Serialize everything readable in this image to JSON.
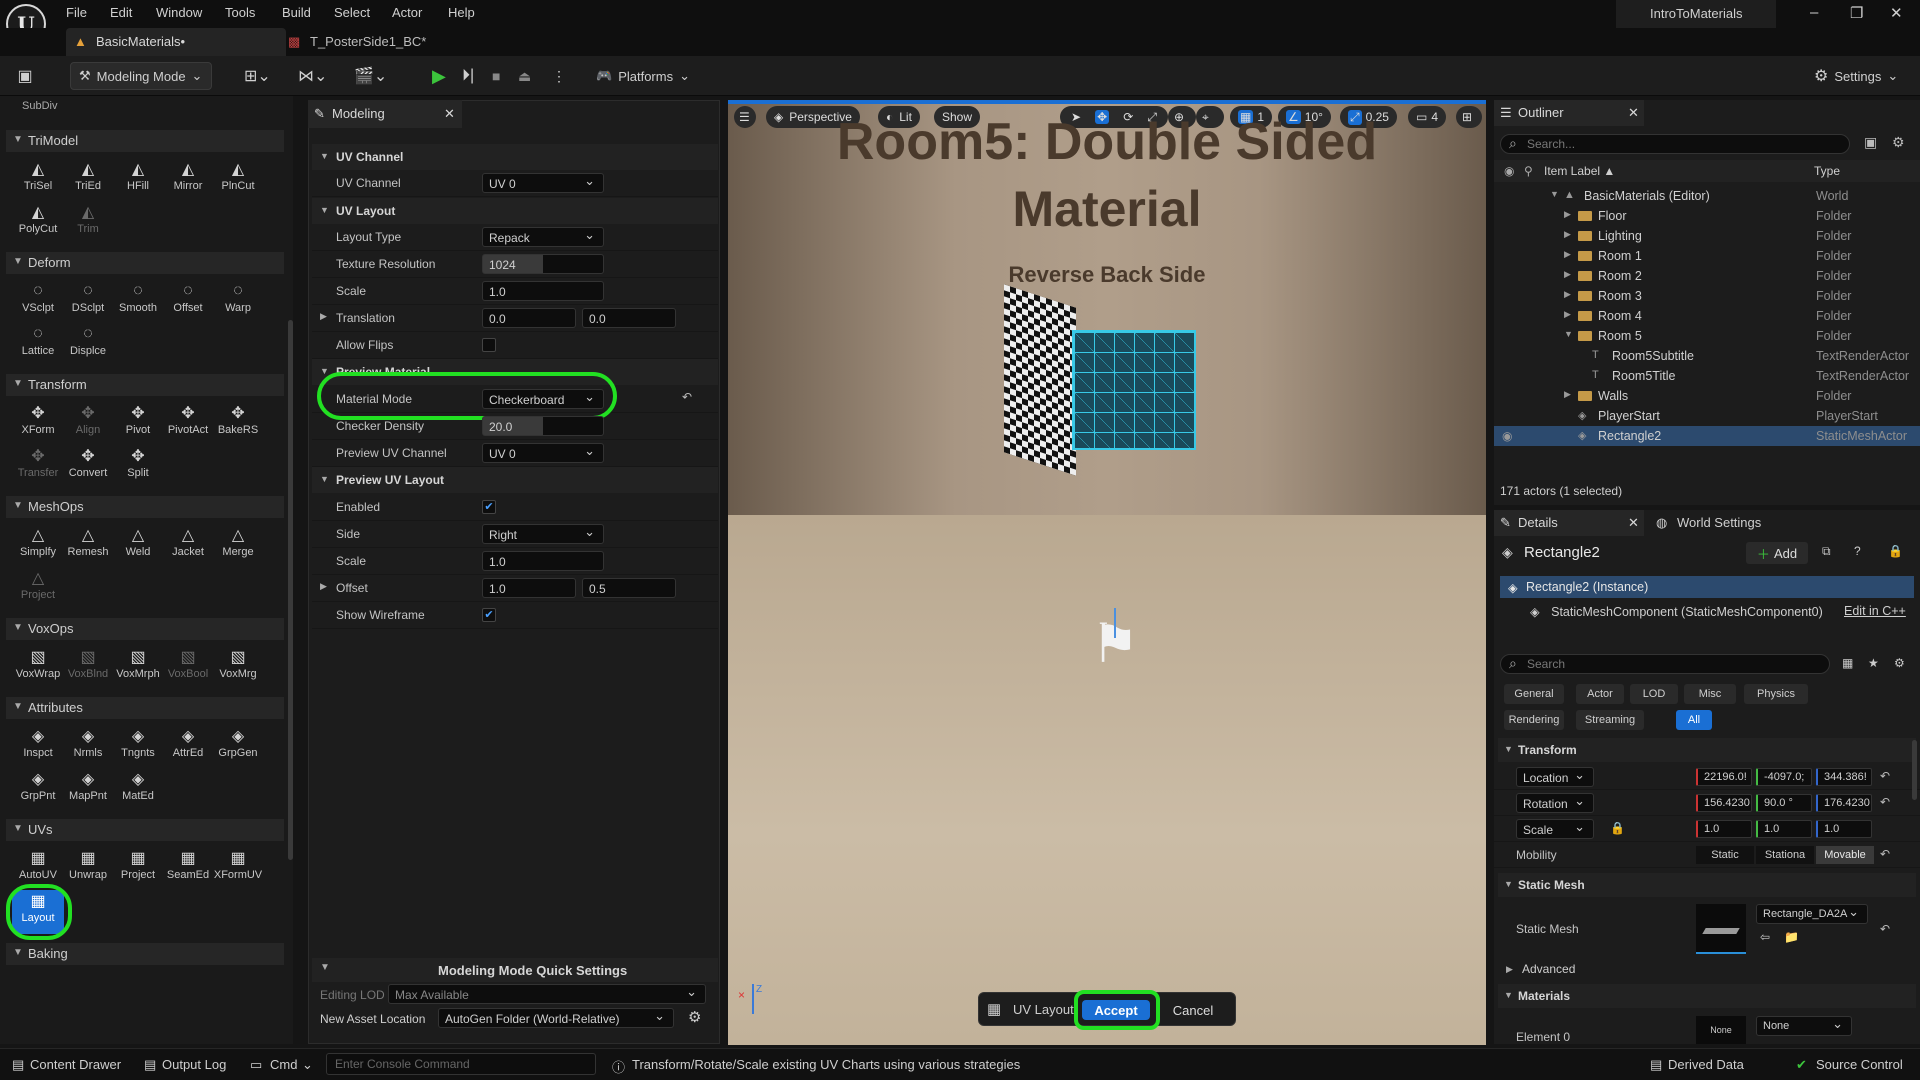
{
  "menu": [
    "File",
    "Edit",
    "Window",
    "Tools",
    "Build",
    "Select",
    "Actor",
    "Help"
  ],
  "project": "IntroToMaterials",
  "tabs": {
    "level": "BasicMaterials•",
    "texture": "T_PosterSide1_BC*"
  },
  "toolbar": {
    "mode": "Modeling Mode",
    "platforms": "Platforms",
    "settings": "Settings"
  },
  "palette": {
    "subdiv": "SubDiv",
    "sections": [
      {
        "name": "TriModel",
        "tools": [
          {
            "label": "TriSel",
            "icon": "triangle-select-icon"
          },
          {
            "label": "TriEd",
            "icon": "triangle-edit-icon"
          },
          {
            "label": "HFill",
            "icon": "hole-fill-icon"
          },
          {
            "label": "Mirror",
            "icon": "mirror-icon"
          },
          {
            "label": "PlnCut",
            "icon": "plane-cut-icon"
          },
          {
            "label": "PolyCut",
            "icon": "poly-cut-icon"
          },
          {
            "label": "Trim",
            "icon": "trim-icon",
            "dim": true
          }
        ]
      },
      {
        "name": "Deform",
        "tools": [
          {
            "label": "VSclpt",
            "icon": "vertex-sculpt-icon"
          },
          {
            "label": "DSclpt",
            "icon": "dynamic-sculpt-icon"
          },
          {
            "label": "Smooth",
            "icon": "smooth-icon"
          },
          {
            "label": "Offset",
            "icon": "offset-icon"
          },
          {
            "label": "Warp",
            "icon": "warp-icon"
          },
          {
            "label": "Lattice",
            "icon": "lattice-icon"
          },
          {
            "label": "Displce",
            "icon": "displace-icon"
          }
        ]
      },
      {
        "name": "Transform",
        "tools": [
          {
            "label": "XForm",
            "icon": "xform-icon"
          },
          {
            "label": "Align",
            "icon": "align-icon",
            "dim": true
          },
          {
            "label": "Pivot",
            "icon": "pivot-icon"
          },
          {
            "label": "PivotAct",
            "icon": "pivot-actor-icon"
          },
          {
            "label": "BakeRS",
            "icon": "bake-rs-icon"
          },
          {
            "label": "Transfer",
            "icon": "transfer-icon",
            "dim": true
          },
          {
            "label": "Convert",
            "icon": "convert-icon"
          },
          {
            "label": "Split",
            "icon": "split-icon"
          }
        ]
      },
      {
        "name": "MeshOps",
        "tools": [
          {
            "label": "Simplfy",
            "icon": "simplify-icon"
          },
          {
            "label": "Remesh",
            "icon": "remesh-icon"
          },
          {
            "label": "Weld",
            "icon": "weld-icon"
          },
          {
            "label": "Jacket",
            "icon": "jacket-icon"
          },
          {
            "label": "Merge",
            "icon": "merge-icon"
          },
          {
            "label": "Project",
            "icon": "project-icon",
            "dim": true
          }
        ]
      },
      {
        "name": "VoxOps",
        "tools": [
          {
            "label": "VoxWrap",
            "icon": "vox-wrap-icon"
          },
          {
            "label": "VoxBlnd",
            "icon": "vox-blend-icon",
            "dim": true
          },
          {
            "label": "VoxMrph",
            "icon": "vox-morph-icon"
          },
          {
            "label": "VoxBool",
            "icon": "vox-bool-icon",
            "dim": true
          },
          {
            "label": "VoxMrg",
            "icon": "vox-merge-icon"
          }
        ]
      },
      {
        "name": "Attributes",
        "tools": [
          {
            "label": "Inspct",
            "icon": "inspect-icon"
          },
          {
            "label": "Nrmls",
            "icon": "normals-icon"
          },
          {
            "label": "Tngnts",
            "icon": "tangents-icon"
          },
          {
            "label": "AttrEd",
            "icon": "attr-edit-icon"
          },
          {
            "label": "GrpGen",
            "icon": "group-gen-icon"
          },
          {
            "label": "GrpPnt",
            "icon": "group-paint-icon"
          },
          {
            "label": "MapPnt",
            "icon": "map-paint-icon"
          },
          {
            "label": "MatEd",
            "icon": "mat-edit-icon"
          }
        ]
      },
      {
        "name": "UVs",
        "tools": [
          {
            "label": "AutoUV",
            "icon": "auto-uv-icon"
          },
          {
            "label": "Unwrap",
            "icon": "unwrap-icon"
          },
          {
            "label": "Project",
            "icon": "uv-project-icon"
          },
          {
            "label": "SeamEd",
            "icon": "seam-edit-icon"
          },
          {
            "label": "XFormUV",
            "icon": "xform-uv-icon"
          }
        ]
      },
      {
        "name": "Baking",
        "tools": []
      }
    ],
    "layout": "Layout"
  },
  "modeling": {
    "tab": "Modeling",
    "uv_channel": {
      "title": "UV Channel",
      "label": "UV Channel",
      "value": "UV 0"
    },
    "uv_layout": {
      "title": "UV Layout",
      "layout_type": "Layout Type",
      "layout_value": "Repack",
      "texres_label": "Texture Resolution",
      "texres": "1024",
      "scale_label": "Scale",
      "scale": "1.0",
      "translation_label": "Translation",
      "tx": "0.0",
      "ty": "0.0",
      "flips_label": "Allow Flips"
    },
    "preview_material": {
      "title": "Preview Material",
      "mode_label": "Material Mode",
      "mode": "Checkerboard",
      "density_label": "Checker Density",
      "density": "20.0",
      "channel_label": "Preview UV Channel",
      "channel": "UV 0"
    },
    "preview_uv": {
      "title": "Preview UV Layout",
      "enabled_label": "Enabled",
      "side_label": "Side",
      "side": "Right",
      "scale_label": "Scale",
      "scale": "1.0",
      "offset_label": "Offset",
      "ox": "1.0",
      "oy": "0.5",
      "wire_label": "Show Wireframe"
    },
    "quick": {
      "title": "Modeling Mode Quick Settings",
      "lod_label": "Editing LOD",
      "lod": "Max Available",
      "loc_label": "New Asset Location",
      "loc": "AutoGen Folder (World-Relative)"
    }
  },
  "viewport": {
    "perspective": "Perspective",
    "lit": "Lit",
    "show": "Show",
    "angle": "10°",
    "scale": "0.25",
    "grid": "1",
    "cam": "4",
    "title1": "Room5: Double Sided",
    "title2": "Material",
    "subtitle": "Reverse Back Side",
    "tool": "UV Layout",
    "accept": "Accept",
    "cancel": "Cancel"
  },
  "outliner": {
    "title": "Outliner",
    "search": "Search...",
    "col_label": "Item Label ▲",
    "col_type": "Type",
    "items": [
      {
        "name": "BasicMaterials (Editor)",
        "type": "World"
      },
      {
        "name": "Floor",
        "type": "Folder"
      },
      {
        "name": "Lighting",
        "type": "Folder"
      },
      {
        "name": "Room 1",
        "type": "Folder"
      },
      {
        "name": "Room 2",
        "type": "Folder"
      },
      {
        "name": "Room 3",
        "type": "Folder"
      },
      {
        "name": "Room 4",
        "type": "Folder"
      },
      {
        "name": "Room 5",
        "type": "Folder"
      },
      {
        "name": "Room5Subtitle",
        "type": "TextRenderActor"
      },
      {
        "name": "Room5Title",
        "type": "TextRenderActor"
      },
      {
        "name": "Walls",
        "type": "Folder"
      },
      {
        "name": "PlayerStart",
        "type": "PlayerStart"
      },
      {
        "name": "Rectangle2",
        "type": "StaticMeshActor"
      }
    ],
    "count": "171 actors (1 selected)"
  },
  "details": {
    "tab": "Details",
    "world_tab": "World Settings",
    "actor": "Rectangle2",
    "add": "Add",
    "instance": "Rectangle2 (Instance)",
    "component": "StaticMeshComponent (StaticMeshComponent0)",
    "edit_cpp": "Edit in C++",
    "search": "Search",
    "cats": [
      "General",
      "Actor",
      "LOD",
      "Misc",
      "Physics",
      "Rendering",
      "Streaming",
      "All"
    ],
    "transform": "Transform",
    "location": {
      "label": "Location",
      "x": "22196.0!",
      "y": "-4097.0;",
      "z": "344.386!"
    },
    "rotation": {
      "label": "Rotation",
      "x": "156.4230",
      "y": "90.0 °",
      "z": "176.4230"
    },
    "scale": {
      "label": "Scale",
      "x": "1.0",
      "y": "1.0",
      "z": "1.0"
    },
    "mobility": {
      "label": "Mobility",
      "static": "Static",
      "stationary": "Stationa",
      "movable": "Movable"
    },
    "static_mesh_sec": "Static Mesh",
    "static_mesh_label": "Static Mesh",
    "mesh": "Rectangle_DA2A",
    "advanced": "Advanced",
    "materials": "Materials",
    "element0": "Element 0",
    "none": "None",
    "thumb": "None"
  },
  "status": {
    "content": "Content Drawer",
    "output": "Output Log",
    "cmd": "Cmd",
    "console": "Enter Console Command",
    "hint": "Transform/Rotate/Scale existing UV Charts using various strategies",
    "derived": "Derived Data",
    "source": "Source Control"
  }
}
